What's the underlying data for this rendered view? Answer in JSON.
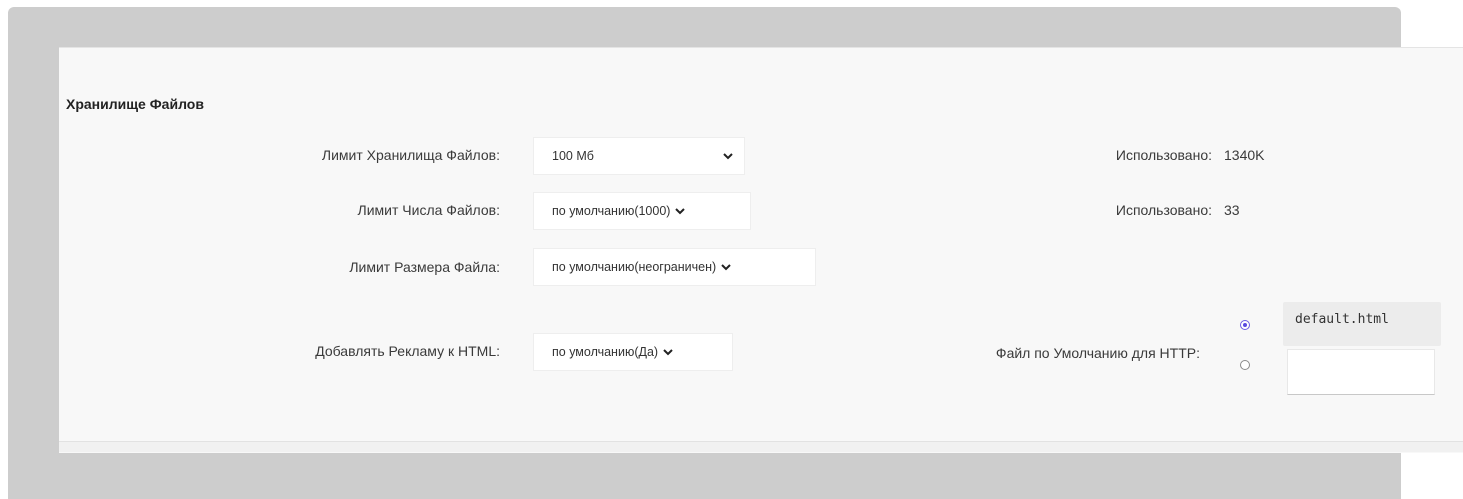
{
  "section": {
    "title": "Хранилище Файлов"
  },
  "rows": {
    "storage_limit": {
      "label": "Лимит Хранилища Файлов:",
      "value": "100 Мб",
      "used_label": "Использовано:",
      "used_value": "1340K"
    },
    "file_count_limit": {
      "label": "Лимит Числа Файлов:",
      "value": "по умолчанию(1000)",
      "used_label": "Использовано:",
      "used_value": "33"
    },
    "file_size_limit": {
      "label": "Лимит Размера Файла:",
      "value": "по умолчанию(неограничен)"
    },
    "add_ads_html": {
      "label": "Добавлять Рекламу к HTML:",
      "value": "по умолчанию(Да)"
    }
  },
  "default_http_file": {
    "label": "Файл по Умолчанию для HTTP:",
    "preset_value": "default.html",
    "preset_selected": true,
    "custom_value": ""
  },
  "colors": {
    "accent_radio": "#5a49e0",
    "backdrop": "#cdcdcd",
    "panel": "#f8f8f8"
  },
  "icons": {
    "select_arrow": "chevron-down-icon"
  }
}
